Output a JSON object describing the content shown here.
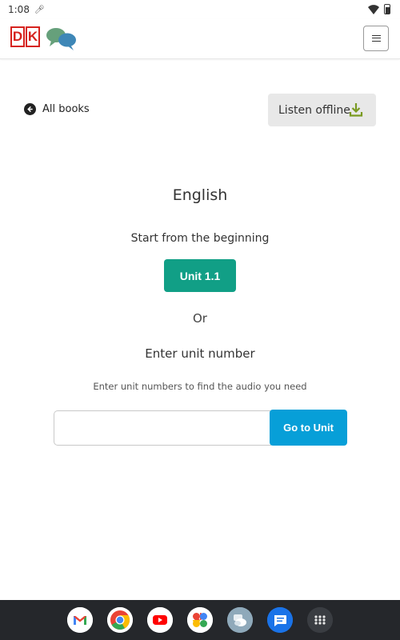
{
  "status_bar": {
    "time": "1:08"
  },
  "header": {
    "logo_left": "D",
    "logo_right": "K",
    "menu_icon": "hamburger-icon"
  },
  "nav": {
    "back_label": "All books",
    "back_icon": "arrow-left-circle-icon",
    "offline_label": "Listen offline",
    "offline_icon": "download-icon",
    "offline_icon_color": "#7a9a21"
  },
  "main": {
    "language": "English",
    "start_label": "Start from the beginning",
    "unit_button": "Unit 1.1",
    "or_label": "Or",
    "enter_label": "Enter unit number",
    "hint": "Enter unit numbers to find the audio you need",
    "input_value": "",
    "go_button": "Go to Unit"
  },
  "colors": {
    "accent_green": "#119f86",
    "accent_blue": "#079fd8",
    "brand_red": "#d6231e"
  },
  "taskbar": {
    "apps": [
      "gmail-icon",
      "chrome-icon",
      "youtube-icon",
      "photos-icon",
      "chat-app-icon",
      "messages-icon",
      "app-drawer-icon"
    ]
  }
}
